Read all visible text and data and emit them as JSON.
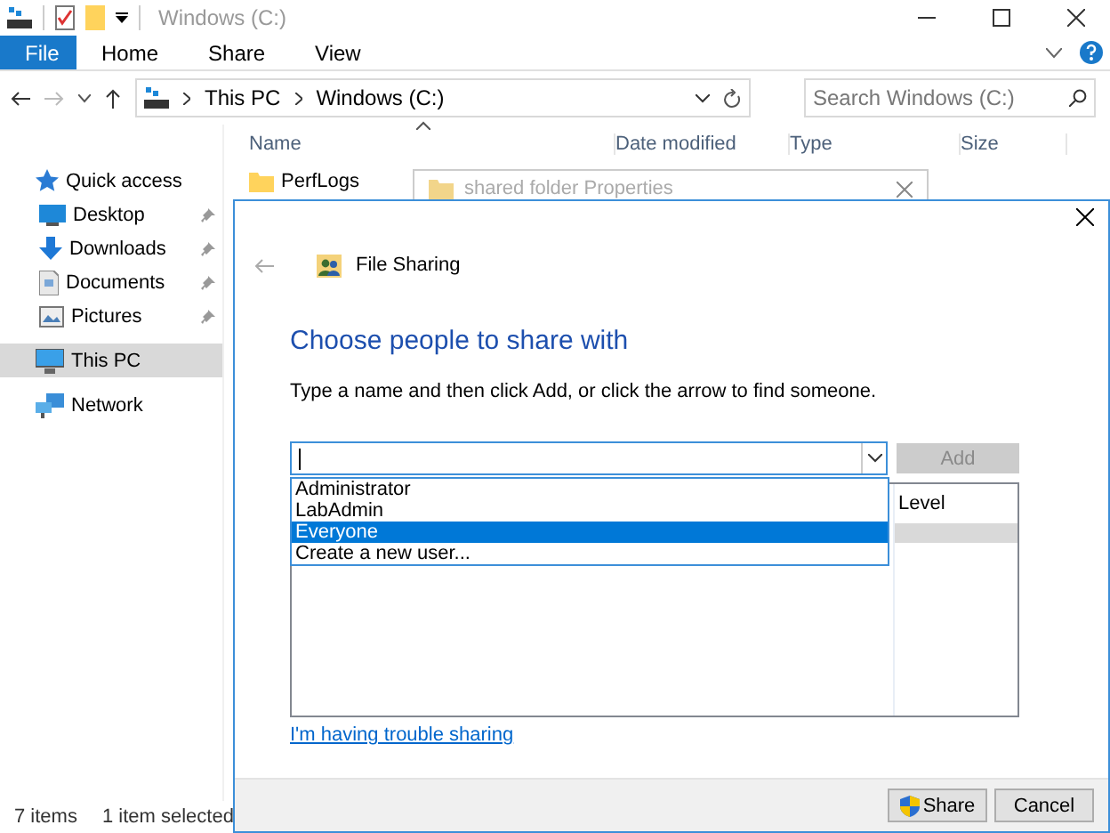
{
  "window": {
    "title": "Windows (C:)"
  },
  "ribbon_tabs": [
    {
      "label": "File",
      "selected": true
    },
    {
      "label": "Home",
      "selected": false
    },
    {
      "label": "Share",
      "selected": false
    },
    {
      "label": "View",
      "selected": false
    }
  ],
  "address": {
    "path": [
      "This PC",
      "Windows (C:)"
    ]
  },
  "search": {
    "placeholder": "Search Windows (C:)"
  },
  "sidebar": {
    "items": [
      {
        "label": "Quick access",
        "kind": "star",
        "selected": false,
        "pinned": false
      },
      {
        "label": "Desktop",
        "kind": "desktop",
        "selected": false,
        "pinned": true
      },
      {
        "label": "Downloads",
        "kind": "download",
        "selected": false,
        "pinned": true
      },
      {
        "label": "Documents",
        "kind": "document",
        "selected": false,
        "pinned": true
      },
      {
        "label": "Pictures",
        "kind": "picture",
        "selected": false,
        "pinned": true
      },
      {
        "label": "This PC",
        "kind": "pc",
        "selected": true,
        "pinned": false
      },
      {
        "label": "Network",
        "kind": "network",
        "selected": false,
        "pinned": false
      }
    ]
  },
  "table": {
    "columns": [
      "Name",
      "Date modified",
      "Type",
      "Size"
    ],
    "rows": [
      {
        "name": "PerfLogs"
      }
    ]
  },
  "status_bar": {
    "items": "7 items",
    "selection": "1 item selected"
  },
  "background_window": {
    "title": "shared folder Properties"
  },
  "dialog": {
    "title": "File Sharing",
    "heading": "Choose people to share with",
    "instruction": "Type a name and then click Add, or click the arrow to find someone.",
    "add_button": {
      "label": "Add",
      "disabled": true
    },
    "dropdown": [
      {
        "label": "Administrator",
        "selected": false
      },
      {
        "label": "LabAdmin",
        "selected": false
      },
      {
        "label": "Everyone",
        "selected": true
      },
      {
        "label": "Create a new user...",
        "selected": false
      }
    ],
    "list_columns": [
      "Level"
    ],
    "link": "I'm having trouble sharing",
    "buttons": [
      {
        "label": "Share",
        "shield": true
      },
      {
        "label": "Cancel",
        "shield": false
      }
    ]
  }
}
